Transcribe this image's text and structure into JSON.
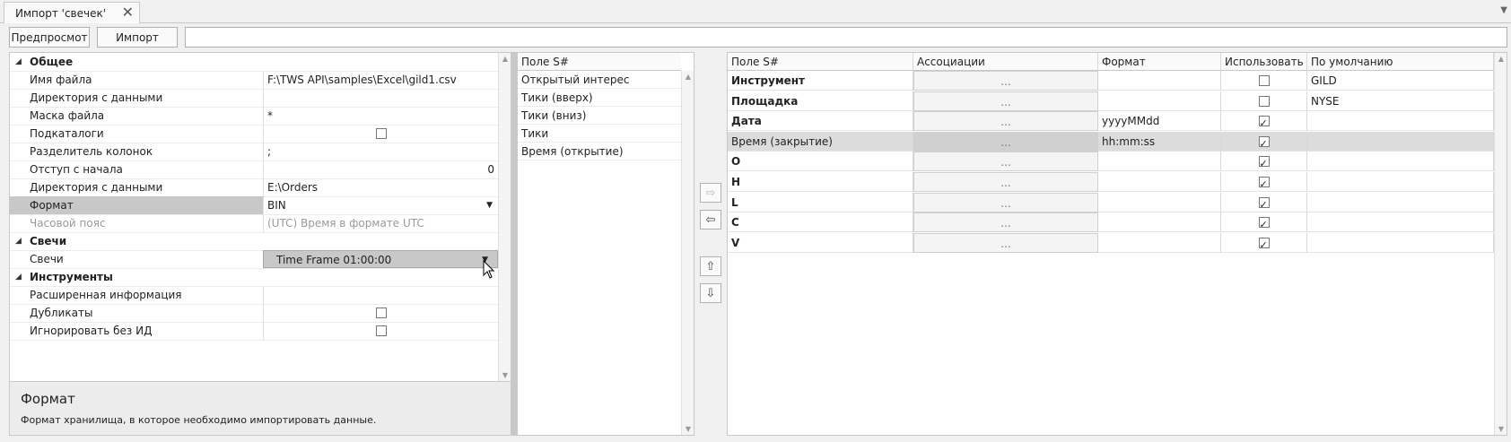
{
  "tab": {
    "title": "Импорт 'свечек'",
    "close": "✕"
  },
  "toolbar": {
    "preview": "Предпросмот",
    "import": "Импорт"
  },
  "props": {
    "general": "Общее",
    "rows": [
      {
        "name": "Имя файла",
        "value": "F:\\TWS API\\samples\\Excel\\gild1.csv"
      },
      {
        "name": "Директория с данными",
        "value": ""
      },
      {
        "name": "Маска файла",
        "value": "*"
      },
      {
        "name": "Подкаталоги",
        "value": ""
      },
      {
        "name": "Разделитель колонок",
        "value": ";"
      },
      {
        "name": "Отступ с начала",
        "value": "0"
      },
      {
        "name": "Директория с данными",
        "value": "E:\\Orders"
      },
      {
        "name": "Формат",
        "value": "BIN"
      },
      {
        "name": "Часовой пояс",
        "value": "(UTC) Время в формате UTC"
      }
    ],
    "candles": "Свечи",
    "candles_row": {
      "name": "Свечи",
      "value": "Time Frame 01:00:00"
    },
    "instruments": "Инструменты",
    "instr_rows": [
      {
        "name": "Расширенная информация",
        "value": ""
      },
      {
        "name": "Дубликаты",
        "value": ""
      },
      {
        "name": "Игнорировать без ИД",
        "value": ""
      }
    ]
  },
  "desc": {
    "title": "Формат",
    "text": "Формат хранилища, в которое необходимо импортировать данные."
  },
  "fields": {
    "header": "Поле S#",
    "items": [
      "Открытый интерес",
      "Тики (вверх)",
      "Тики (вниз)",
      "Тики",
      "Время (открытие)"
    ]
  },
  "grid": {
    "headers": [
      "Поле S#",
      "Ассоциации",
      "Формат",
      "Использовать",
      "По умолчанию"
    ],
    "rows": [
      {
        "field": "Инструмент",
        "assoc": "...",
        "format": "",
        "use": false,
        "default": "GILD",
        "bold": true
      },
      {
        "field": "Площадка",
        "assoc": "...",
        "format": "",
        "use": false,
        "default": "NYSE",
        "bold": true
      },
      {
        "field": "Дата",
        "assoc": "...",
        "format": "yyyyMMdd",
        "use": true,
        "default": "",
        "bold": true
      },
      {
        "field": "Время (закрытие)",
        "assoc": "...",
        "format": "hh:mm:ss",
        "use": true,
        "default": "",
        "bold": false
      },
      {
        "field": "O",
        "assoc": "...",
        "format": "",
        "use": true,
        "default": "",
        "bold": true
      },
      {
        "field": "H",
        "assoc": "...",
        "format": "",
        "use": true,
        "default": "",
        "bold": true
      },
      {
        "field": "L",
        "assoc": "...",
        "format": "",
        "use": true,
        "default": "",
        "bold": true
      },
      {
        "field": "C",
        "assoc": "...",
        "format": "",
        "use": true,
        "default": "",
        "bold": true
      },
      {
        "field": "V",
        "assoc": "...",
        "format": "",
        "use": true,
        "default": "",
        "bold": true
      }
    ]
  },
  "icons": {
    "arrow_right": "⇨",
    "arrow_left": "⇦",
    "arrow_up": "⇧",
    "arrow_down": "⇩",
    "expand": "◢",
    "dropdown": "▼",
    "scroll_up": "▲",
    "scroll_down": "▼"
  }
}
